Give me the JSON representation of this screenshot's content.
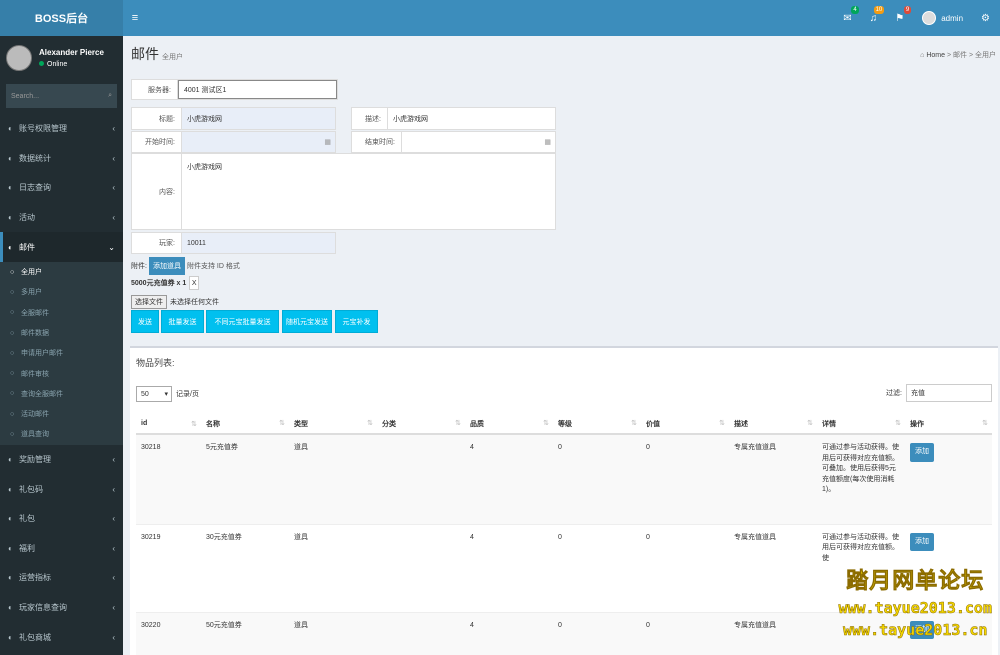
{
  "app": {
    "logo": "BOSS后台",
    "toggle": "≡"
  },
  "topbar": {
    "mail_badge": "4",
    "mail_badge_color": "#00a65a",
    "notif_badge": "10",
    "notif_badge_color": "#f39c12",
    "flag_badge": "9",
    "flag_badge_color": "#dd4b39",
    "user": "admin"
  },
  "sidebar": {
    "profile": {
      "name": "Alexander Pierce",
      "status": "Online"
    },
    "search_placeholder": "Search...",
    "items_top": [
      {
        "label": "账号权限管理"
      },
      {
        "label": "数据统计"
      },
      {
        "label": "日志查询"
      },
      {
        "label": "活动"
      },
      {
        "label": "邮件"
      }
    ],
    "sub_items": [
      {
        "label": "全用户"
      },
      {
        "label": "多用户"
      },
      {
        "label": "全服邮件"
      },
      {
        "label": "邮件数据"
      },
      {
        "label": "申请用户邮件"
      },
      {
        "label": "邮件审核"
      },
      {
        "label": "查询全服邮件"
      },
      {
        "label": "活动邮件"
      },
      {
        "label": "道具查询"
      }
    ],
    "items_bottom": [
      {
        "label": "奖励管理"
      },
      {
        "label": "礼包码"
      },
      {
        "label": "礼包"
      },
      {
        "label": "福利"
      },
      {
        "label": "运营指标"
      },
      {
        "label": "玩家信息查询"
      },
      {
        "label": "礼包商城"
      }
    ]
  },
  "page": {
    "title": "邮件",
    "subtitle": "全用户",
    "breadcrumb": {
      "home": "Home",
      "sep": ">",
      "b1": "邮件",
      "b2": "全用户"
    }
  },
  "form": {
    "server_label": "服务器:",
    "server_value": "4001 测试区1",
    "title_label": "标题:",
    "title_value": "小虎游戏网",
    "desc_label": "描述:",
    "desc_value": "小虎游戏网",
    "start_label": "开始时间:",
    "end_label": "结束时间:",
    "content_label": "内容:",
    "content_value": "小虎游戏网",
    "player_label": "玩家:",
    "player_value": "10011",
    "attach_label": "附件:",
    "attach_button": "添加道具",
    "attach_note": "附件支持 ID 格式",
    "attached_item": "5000元充值券 x 1",
    "remove": "X",
    "choose_file": "选择文件",
    "no_file": "未选择任何文件"
  },
  "actions": [
    "发送",
    "批量发送",
    "不同元宝批量发送",
    "随机元宝发送",
    "元宝补发"
  ],
  "list": {
    "title": "物品列表:",
    "page_size": "50",
    "page_size_suffix": "记录/页",
    "filter_label": "过滤:",
    "filter_value": "充值",
    "columns": [
      "id",
      "名称",
      "类型",
      "分类",
      "品质",
      "等级",
      "价值",
      "描述",
      "详情",
      "操作"
    ],
    "rows": [
      {
        "id": "30218",
        "name": "5元充值券",
        "type": "道具",
        "cat": "",
        "quality": "4",
        "level": "0",
        "value": "0",
        "desc": "专属充值道具",
        "detail": "可通过参与活动获得。使用后可获得对应充值额。可叠加。使用后获得5元充值额度(每次使用消耗1)。",
        "op": "添加"
      },
      {
        "id": "30219",
        "name": "30元充值券",
        "type": "道具",
        "cat": "",
        "quality": "4",
        "level": "0",
        "value": "0",
        "desc": "专属充值道具",
        "detail": "可通过参与活动获得。使用后可获得对应充值额。使",
        "op": "添加"
      },
      {
        "id": "30220",
        "name": "50元充值券",
        "type": "道具",
        "cat": "",
        "quality": "4",
        "level": "0",
        "value": "0",
        "desc": "专属充值道具",
        "detail": "",
        "op": "添加"
      }
    ]
  },
  "watermark": {
    "line1": "踏月网单论坛",
    "line2": "www.tayue2013.com",
    "line3": "www.tayue2013.cn"
  }
}
